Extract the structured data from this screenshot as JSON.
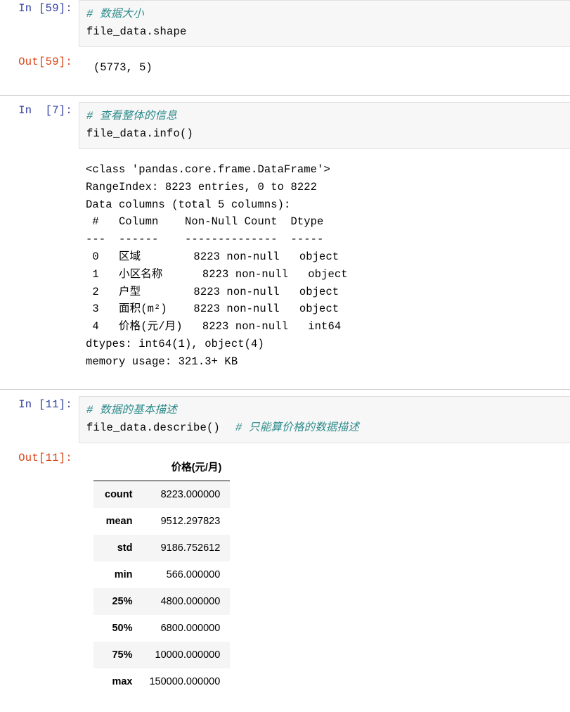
{
  "notebook": {
    "cells": [
      {
        "id": "cell-shape",
        "in_prompt": "In [59]:",
        "out_prompt": "Out[59]:",
        "code": {
          "comment_line": "# 数据大小",
          "code_line": "file_data.shape"
        },
        "result": "(5773, 5)"
      },
      {
        "id": "cell-info",
        "in_prompt": "In  [7]:",
        "code": {
          "comment_line": "# 查看整体的信息",
          "code_line": "file_data.info()"
        },
        "stream_output": "<class 'pandas.core.frame.DataFrame'>\nRangeIndex: 8223 entries, 0 to 8222\nData columns (total 5 columns):\n #   Column    Non-Null Count  Dtype\n---  ------    --------------  -----\n 0   区域        8223 non-null   object\n 1   小区名称      8223 non-null   object\n 2   户型        8223 non-null   object\n 3   面积(m²)    8223 non-null   object\n 4   价格(元/月)   8223 non-null   int64\ndtypes: int64(1), object(4)\nmemory usage: 321.3+ KB"
      },
      {
        "id": "cell-describe",
        "in_prompt": "In [11]:",
        "out_prompt": "Out[11]:",
        "code": {
          "comment_line": "# 数据的基本描述",
          "code_line": "file_data.describe()",
          "trailing_comment": "# 只能算价格的数据描述"
        },
        "table": {
          "corner_label": "",
          "columns": [
            "价格(元/月)"
          ],
          "index": [
            "count",
            "mean",
            "std",
            "min",
            "25%",
            "50%",
            "75%",
            "max"
          ],
          "rows": [
            [
              "count",
              "8223.000000"
            ],
            [
              "mean",
              "9512.297823"
            ],
            [
              "std",
              "9186.752612"
            ],
            [
              "min",
              "566.000000"
            ],
            [
              "25%",
              "4800.000000"
            ],
            [
              "50%",
              "6800.000000"
            ],
            [
              "75%",
              "10000.000000"
            ],
            [
              "max",
              "150000.000000"
            ]
          ]
        }
      }
    ]
  },
  "colors": {
    "in_prompt": "#303f9f",
    "out_prompt": "#d84315",
    "comment": "#2e8b8b",
    "input_background": "#f7f7f7",
    "input_border": "#e0e0e0",
    "cell_divider": "#cfcfcf",
    "table_stripe": "#f5f5f5",
    "table_rule": "#111111"
  }
}
